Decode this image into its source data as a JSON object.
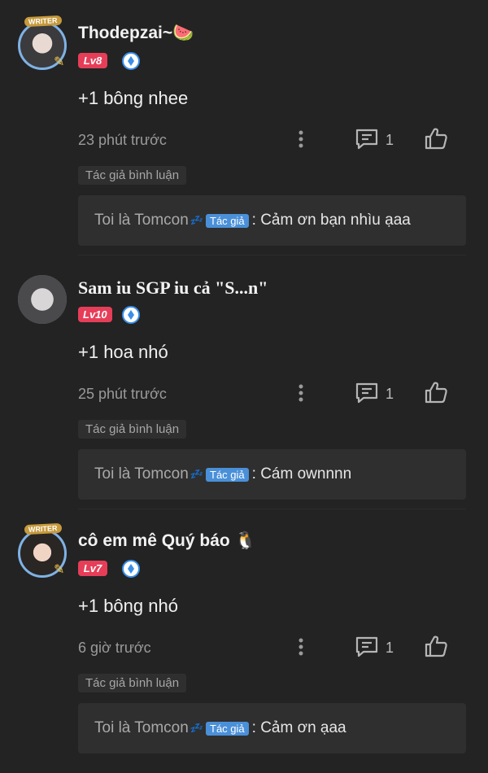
{
  "comments": [
    {
      "username": "Thodepzai~🍉",
      "level": "Lv8",
      "text": "+1 bông nhee",
      "time": "23 phút trước",
      "reply_count": "1",
      "author_tag": "Tác giả bình luận",
      "reply": {
        "user": "Toi là Tomcon",
        "author_label": "Tác giả",
        "text": ": Cảm ơn bạn nhìu ạaa"
      },
      "avatar_badge": "WRITER"
    },
    {
      "username": "Sam iu SGP iu cả \"S...n\"",
      "level": "Lv10",
      "text": "+1 hoa nhó",
      "time": "25 phút trước",
      "reply_count": "1",
      "author_tag": "Tác giả bình luận",
      "reply": {
        "user": "Toi là Tomcon",
        "author_label": "Tác giả",
        "text": ": Cám ownnnn"
      }
    },
    {
      "username": "cô em mê Quý báo 🐧",
      "level": "Lv7",
      "text": "+1 bông nhó",
      "time": "6 giờ trước",
      "reply_count": "1",
      "author_tag": "Tác giả bình luận",
      "reply": {
        "user": "Toi là Tomcon",
        "author_label": "Tác giả",
        "text": ": Cảm ơn ạaa"
      },
      "avatar_badge": "WRITER"
    }
  ],
  "icons": {
    "zz": "💤",
    "more": "more-vertical-icon",
    "reply": "comment-icon",
    "like": "thumbs-up-icon"
  },
  "colors": {
    "background": "#232323",
    "level_badge": "#e63e58",
    "author_pill": "#4a90d9"
  }
}
